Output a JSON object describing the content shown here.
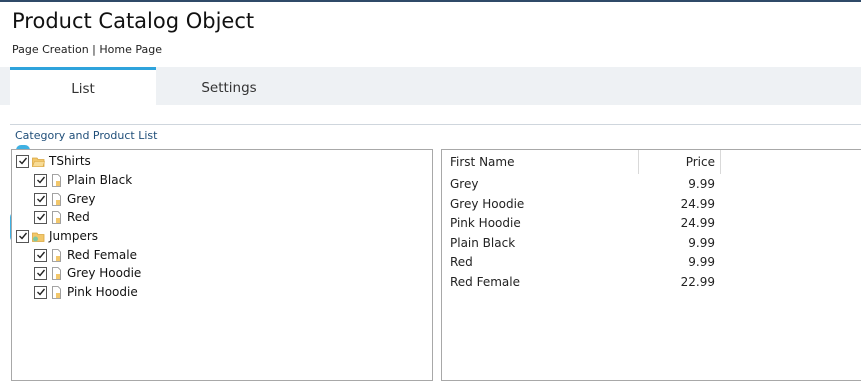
{
  "window": {
    "title": "Product Catalog Object",
    "breadcrumb": "Page Creation | Home Page"
  },
  "tabs": [
    {
      "label": "List",
      "active": true
    },
    {
      "label": "Settings",
      "active": false
    }
  ],
  "section": {
    "label": "Category and Product List"
  },
  "tree": {
    "categories": [
      {
        "label": "TShirts",
        "checked": true,
        "icon": "folder-open-icon",
        "items": [
          {
            "label": "Plain Black",
            "checked": true,
            "icon": "document-icon"
          },
          {
            "label": "Grey",
            "checked": true,
            "icon": "document-icon"
          },
          {
            "label": "Red",
            "checked": true,
            "icon": "document-icon"
          }
        ]
      },
      {
        "label": "Jumpers",
        "checked": true,
        "icon": "folder-icon",
        "items": [
          {
            "label": "Red Female",
            "checked": true,
            "icon": "document-icon"
          },
          {
            "label": "Grey Hoodie",
            "checked": true,
            "icon": "document-icon"
          },
          {
            "label": "Pink Hoodie",
            "checked": true,
            "icon": "document-icon"
          }
        ]
      }
    ]
  },
  "grid": {
    "columns": [
      "First Name",
      "Price"
    ],
    "rows": [
      {
        "name": "Grey",
        "price": "9.99"
      },
      {
        "name": "Grey Hoodie",
        "price": "24.99"
      },
      {
        "name": "Pink Hoodie",
        "price": "24.99"
      },
      {
        "name": "Plain Black",
        "price": "9.99"
      },
      {
        "name": "Red",
        "price": "9.99"
      },
      {
        "name": "Red Female",
        "price": "22.99"
      }
    ]
  },
  "colors": {
    "tab_accent": "#2ea3dc",
    "section_label": "#1f4e79",
    "highlight": "#2aa9e0",
    "folder": "#f2c76b"
  }
}
